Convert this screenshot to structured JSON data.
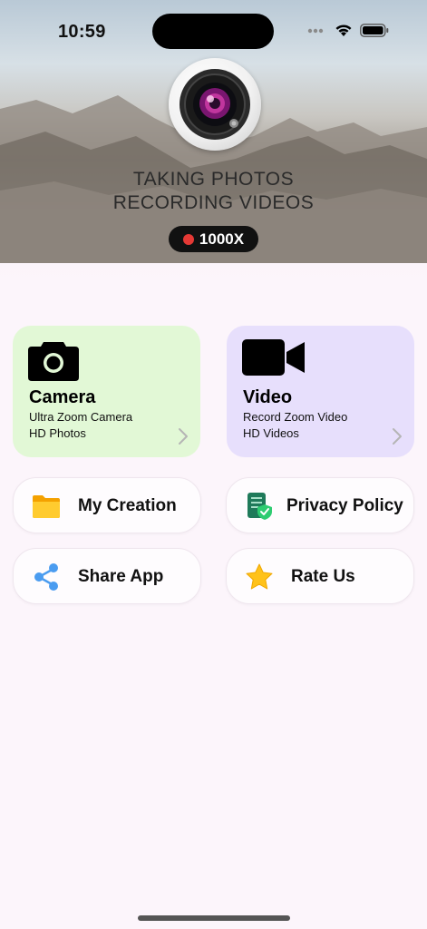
{
  "status_bar": {
    "time": "10:59",
    "icons": [
      "cellular-icon",
      "wifi-icon",
      "battery-icon"
    ]
  },
  "header": {
    "logo_icon": "camera-lens-icon",
    "tagline_line1": "TAKING PHOTOS",
    "tagline_line2": "RECORDING VIDEOS",
    "zoom_badge": "1000X",
    "badge_dot_color": "#e53935"
  },
  "cards": {
    "camera": {
      "title": "Camera",
      "line1": "Ultra Zoom Camera",
      "line2": "HD Photos",
      "icon": "camera-icon",
      "bg_color": "#e2f8d6"
    },
    "video": {
      "title": "Video",
      "line1": "Record Zoom Video",
      "line2": "HD Videos",
      "icon": "video-camera-icon",
      "bg_color": "#e7dffc"
    }
  },
  "menu": {
    "my_creation": {
      "label": "My Creation",
      "icon": "folder-icon"
    },
    "privacy_policy": {
      "label": "Privacy Policy",
      "icon": "shield-document-icon"
    },
    "share_app": {
      "label": "Share App",
      "icon": "share-icon"
    },
    "rate_us": {
      "label": "Rate Us",
      "icon": "star-icon"
    }
  }
}
